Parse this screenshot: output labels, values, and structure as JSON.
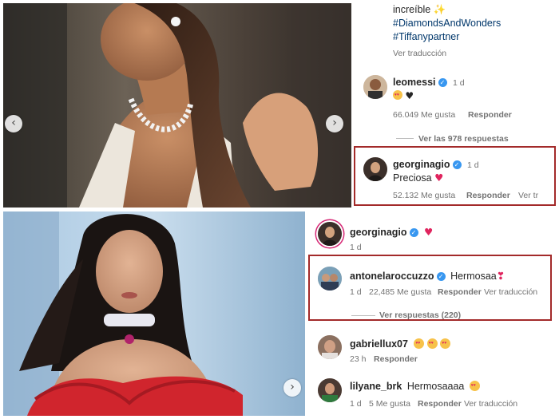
{
  "top_post": {
    "caption": {
      "line1": "increíble",
      "line1_emoji": "sparkles",
      "hashtag1": "#DiamondsAndWonders",
      "hashtag2": "#Tiffanypartner",
      "see_translation": "Ver traducción"
    },
    "comments": [
      {
        "username": "leomessi",
        "verified": true,
        "time": "1 d",
        "text_emojis": [
          "heart-eyes-emoji",
          "black-heart"
        ],
        "likes": "66.049 Me gusta",
        "reply": "Responder"
      },
      {
        "username": "georginagio",
        "verified": true,
        "time": "1 d",
        "text": "Preciosa",
        "text_emojis": [
          "red-heart"
        ],
        "likes": "52.132 Me gusta",
        "reply": "Responder",
        "see_translation": "Ver tr"
      }
    ],
    "view_replies": "Ver las 978 respuestas",
    "carousel_prev": "‹",
    "carousel_next": "›"
  },
  "bottom_post": {
    "comments": [
      {
        "username": "georginagio",
        "verified": true,
        "text_emojis": [
          "red-heart"
        ],
        "time": "1 d"
      },
      {
        "username": "antonelaroccuzzo",
        "verified": true,
        "text": "Hermosaa",
        "text_emojis": [
          "heart-exclamation"
        ],
        "time": "1 d",
        "likes": "22,485 Me gusta",
        "reply": "Responder",
        "see_translation": "Ver traducción"
      },
      {
        "username": "gabriellux07",
        "text_emojis": [
          "heart-eyes-emoji",
          "heart-eyes-emoji",
          "heart-eyes-emoji"
        ],
        "time": "23 h",
        "reply": "Responder"
      },
      {
        "username": "lilyane_brk",
        "text": "Hermosaaaa",
        "text_emojis": [
          "heart-eyes-emoji"
        ],
        "time": "1 d",
        "likes": "5 Me gusta",
        "reply": "Responder",
        "see_translation": "Ver traducción"
      }
    ],
    "view_replies": "Ver respuestas (220)",
    "carousel_next": "›"
  },
  "colors": {
    "highlight_border": "#a32a2a",
    "verified_blue": "#3897f0",
    "hashtag_blue": "#00376b",
    "muted_text": "#737373",
    "heart_red": "#e0245e"
  }
}
